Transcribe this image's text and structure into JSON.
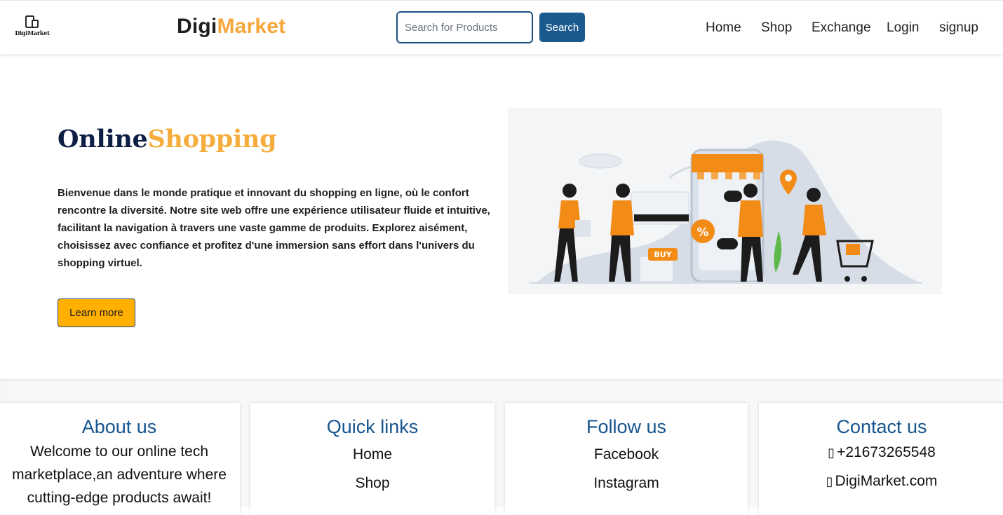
{
  "header": {
    "logo_caption": "DigiMarket",
    "brand_part1": "Digi",
    "brand_part2": "Market",
    "search_placeholder": "Search for Products",
    "search_button": "Search",
    "nav": [
      "Home",
      "Shop",
      "Exchange",
      "Login",
      "signup"
    ]
  },
  "hero": {
    "title_part1": "Online",
    "title_part2": "Shopping",
    "description": "Bienvenue dans le monde pratique et innovant du shopping en ligne, où le confort rencontre la diversité. Notre site web offre une expérience utilisateur fluide et intuitive, facilitant la navigation à travers une vaste gamme de produits. Explorez aisément, choisissez avec confiance et profitez d'une immersion sans effort dans l'univers du shopping virtuel.",
    "button": "Learn more",
    "illustration_label": "BUY"
  },
  "footer": {
    "about": {
      "heading": "About us",
      "text": [
        "Welcome to our online tech",
        "marketplace,an adventure where",
        "cutting-edge products await!"
      ]
    },
    "quick_links": {
      "heading": "Quick links",
      "links": [
        "Home",
        "Shop"
      ]
    },
    "follow": {
      "heading": "Follow us",
      "links": [
        "Facebook",
        "Instagram"
      ]
    },
    "contact": {
      "heading": "Contact us",
      "phone": "+21673265548",
      "website": "DigiMarket.com",
      "phone_icon": "phone-icon",
      "web_icon": "globe-icon"
    }
  },
  "colors": {
    "brand_orange": "#f5a73b",
    "brand_dark": "#0e1f45",
    "primary_blue": "#1a5a8e",
    "button_yellow": "#ffb000",
    "heading_blue": "#17558f"
  }
}
